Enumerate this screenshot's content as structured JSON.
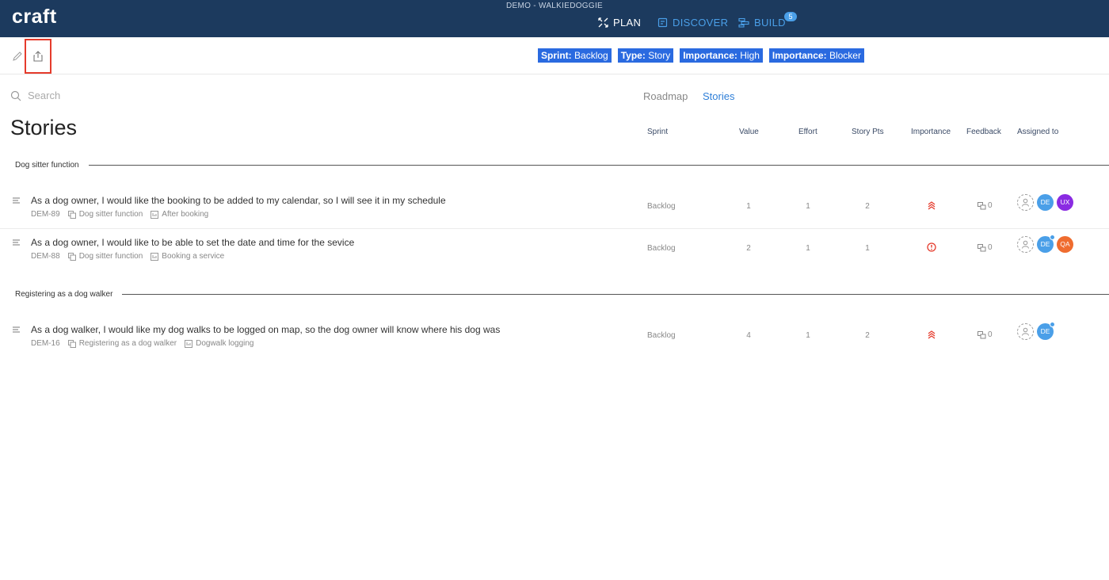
{
  "app": {
    "logo": "craft",
    "project": "DEMO - WALKIEDOGGIE",
    "nav": {
      "plan": "PLAN",
      "discover": "DISCOVER",
      "build": "BUILD",
      "build_badge": "5"
    }
  },
  "filters": [
    {
      "key": "Sprint:",
      "value": "Backlog"
    },
    {
      "key": "Type:",
      "value": "Story"
    },
    {
      "key": "Importance:",
      "value": "High"
    },
    {
      "key": "Importance:",
      "value": "Blocker"
    }
  ],
  "search": {
    "placeholder": "Search"
  },
  "tabs": {
    "roadmap": "Roadmap",
    "stories": "Stories"
  },
  "page_title": "Stories",
  "columns": {
    "sprint": "Sprint",
    "value": "Value",
    "effort": "Effort",
    "story_pts": "Story Pts",
    "importance": "Importance",
    "feedback": "Feedback",
    "assigned_to": "Assigned to"
  },
  "groups": [
    {
      "label": "Dog sitter function",
      "stories": [
        {
          "title": "As a dog owner, I would like the booking to be added to my calendar, so I will see it in my schedule",
          "id": "DEM-89",
          "epic": "Dog sitter function",
          "feature": "After booking",
          "sprint": "Backlog",
          "value": "1",
          "effort": "1",
          "story_pts": "2",
          "importance": "high",
          "feedback": "0",
          "assignees": [
            {
              "initials": "DE",
              "color": "#4a9fe8"
            },
            {
              "initials": "UX",
              "color": "#8a2be2"
            }
          ]
        },
        {
          "title": "As a dog owner, I would like to be able to set the date and time for the sevice",
          "id": "DEM-88",
          "epic": "Dog sitter function",
          "feature": "Booking a service",
          "sprint": "Backlog",
          "value": "2",
          "effort": "1",
          "story_pts": "1",
          "importance": "blocker",
          "feedback": "0",
          "assignees": [
            {
              "initials": "DE",
              "color": "#4a9fe8"
            },
            {
              "initials": "QA",
              "color": "#ef6c2f"
            }
          ]
        }
      ]
    },
    {
      "label": "Registering as a dog walker",
      "stories": [
        {
          "title": "As a dog walker, I would like my dog walks to be logged on map, so the dog owner will know where his dog was",
          "id": "DEM-16",
          "epic": "Registering as a dog walker",
          "feature": "Dogwalk logging",
          "sprint": "Backlog",
          "value": "4",
          "effort": "1",
          "story_pts": "2",
          "importance": "high",
          "feedback": "0",
          "assignees": [
            {
              "initials": "DE",
              "color": "#4a9fe8"
            }
          ]
        }
      ]
    }
  ],
  "colors": {
    "topbar": "#1c3a5e",
    "accent": "#2a6ae0",
    "link": "#4a9fe8",
    "danger": "#e53b2c"
  },
  "icons": [
    "pencil-icon",
    "share-icon",
    "search-icon",
    "plan-icon",
    "discover-icon",
    "build-icon",
    "drag-handle-icon",
    "epic-icon",
    "feature-icon",
    "importance-high-icon",
    "importance-blocker-icon",
    "feedback-icon",
    "assign-user-icon"
  ]
}
